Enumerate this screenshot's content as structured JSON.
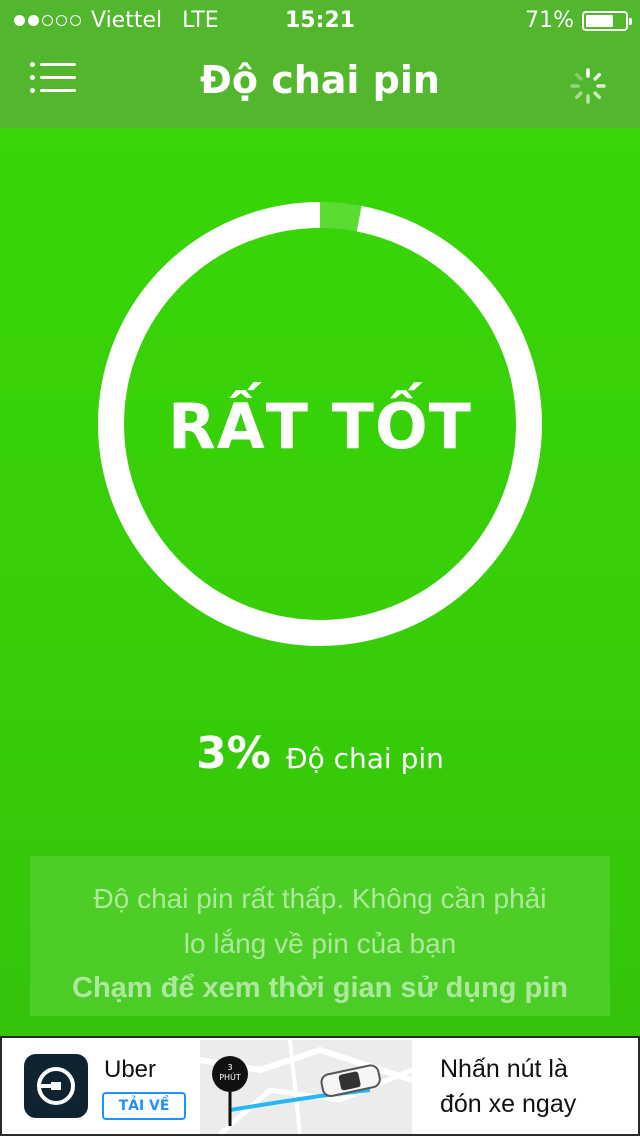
{
  "status_bar": {
    "carrier": "Viettel",
    "network": "LTE",
    "time": "15:21",
    "battery_percent": "71%",
    "battery_level": 0.71,
    "signal_bars_filled": 2,
    "signal_bars_total": 5
  },
  "nav": {
    "title": "Độ chai pin",
    "menu_icon": "list-menu-icon",
    "right_icon": "loading-spinner-icon"
  },
  "gauge": {
    "label": "RẤT TỐT",
    "value_fraction": 0.97,
    "ring_color": "#ffffff"
  },
  "stat": {
    "value": "3%",
    "label": "Độ chai pin"
  },
  "info": {
    "message_line1": "Độ chai pin rất thấp. Không cần phải",
    "message_line2": "lo lắng về pin của bạn",
    "tap_hint": "Chạm để xem thời gian sử dụng pin"
  },
  "ad": {
    "brand": "Uber",
    "download_label": "TẢI VỀ",
    "pin_number": "3",
    "pin_unit": "PHÚT",
    "tagline_line1": "Nhấn nút là",
    "tagline_line2": "đón xe ngay"
  },
  "colors": {
    "accent": "#38d806",
    "topbar": "#53b72e",
    "download_blue": "#1e90ff"
  }
}
